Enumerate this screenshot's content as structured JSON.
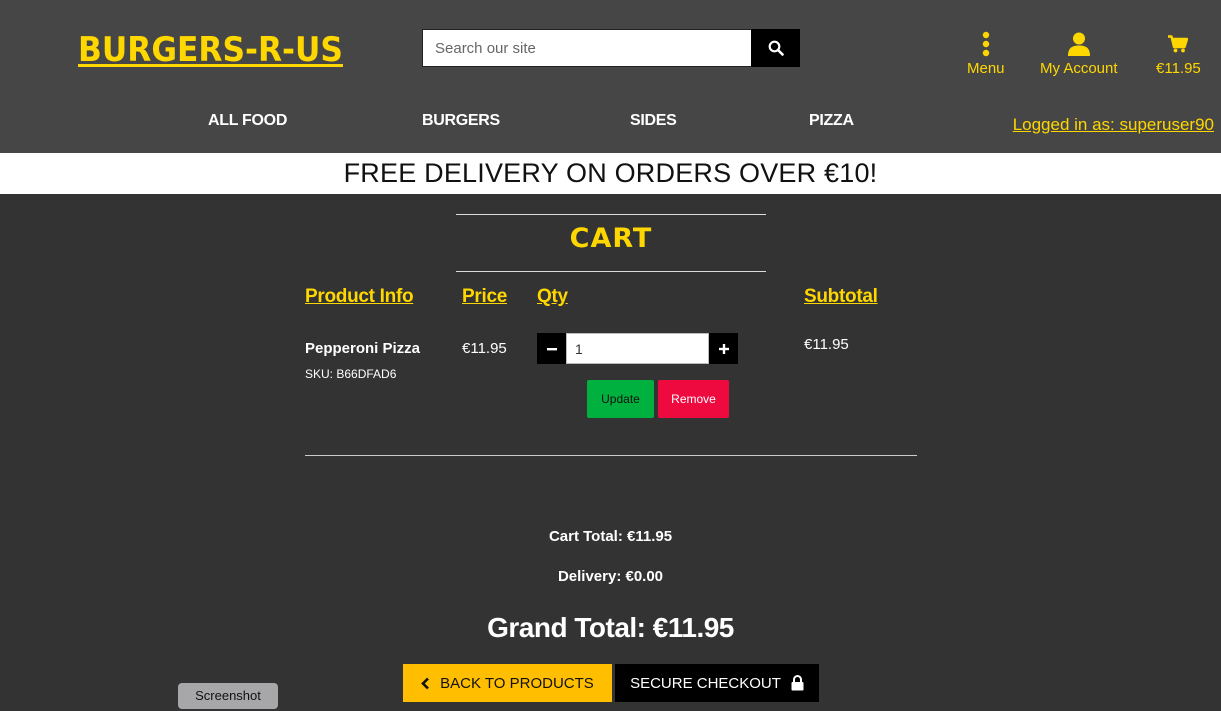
{
  "brand": {
    "logo": "BURGERS-R-US",
    "accent": "#ffd700"
  },
  "search": {
    "placeholder": "Search our site",
    "value": ""
  },
  "header_icons": {
    "menu_label": "Menu",
    "account_label": "My Account",
    "cart_total": "€11.95"
  },
  "nav": {
    "items": [
      "ALL FOOD",
      "BURGERS",
      "SIDES",
      "PIZZA"
    ]
  },
  "user": {
    "logged_in": "Logged in as: superuser90"
  },
  "banner": {
    "text": "FREE DELIVERY ON ORDERS OVER €10!"
  },
  "cart": {
    "title": "CART",
    "headers": {
      "product": "Product Info",
      "price": "Price",
      "qty": "Qty",
      "subtotal": "Subtotal"
    },
    "items": [
      {
        "name": "Pepperoni Pizza",
        "sku": "SKU: B66DFAD6",
        "price": "€11.95",
        "qty": "1",
        "subtotal": "€11.95",
        "update_label": "Update",
        "remove_label": "Remove"
      }
    ],
    "cart_total": "Cart Total: €11.95",
    "delivery": "Delivery: €0.00",
    "grand_total": "Grand Total: €11.95",
    "back_label": "BACK TO PRODUCTS",
    "checkout_label": "SECURE CHECKOUT"
  },
  "tooltip": {
    "text": "Screenshot"
  },
  "colors": {
    "header_bg": "#464646",
    "page_bg": "#333333",
    "update_green": "#00b140",
    "remove_red": "#ee0a3f",
    "back_btn": "#ffbf00"
  }
}
